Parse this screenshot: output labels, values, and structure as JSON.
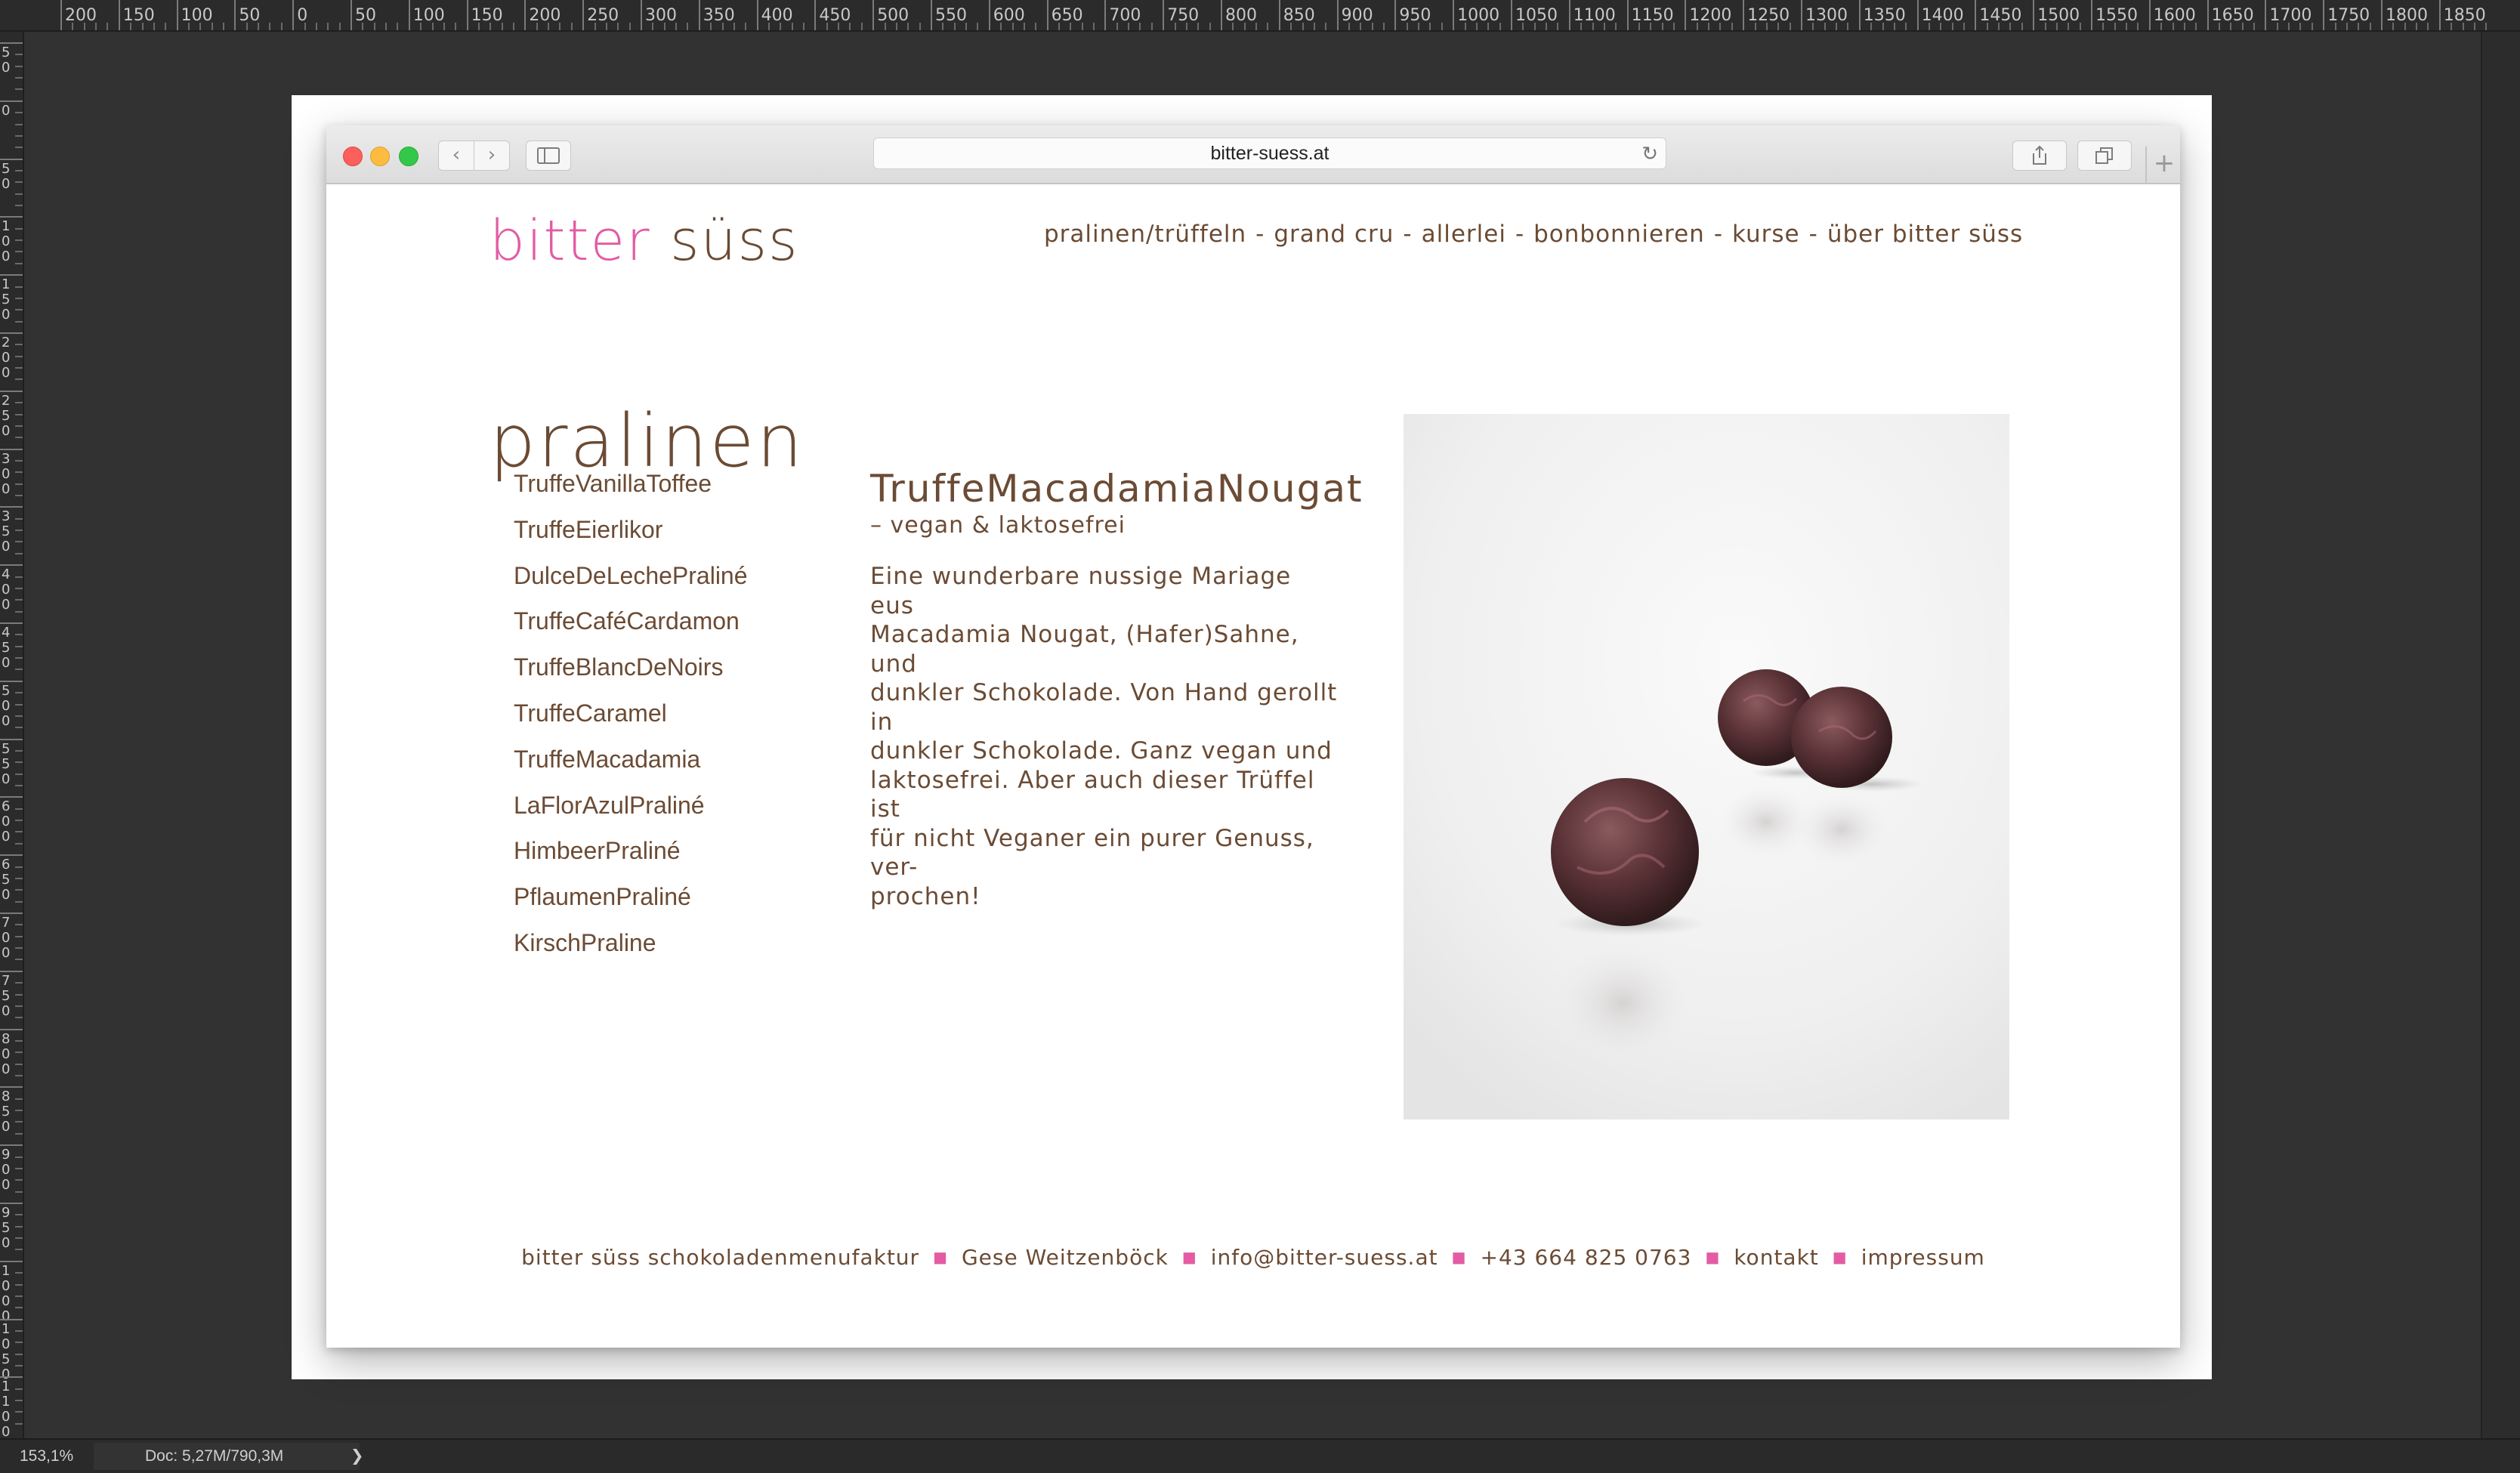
{
  "photoshop": {
    "ruler_labels": [
      "200",
      "150",
      "100",
      "50",
      "0",
      "50",
      "100",
      "150",
      "200",
      "250",
      "300",
      "350",
      "400",
      "450",
      "500",
      "550",
      "600",
      "650",
      "700",
      "750",
      "800",
      "850",
      "900",
      "950",
      "1000",
      "1050",
      "1100",
      "1150",
      "1200",
      "1250",
      "1300",
      "1350",
      "1400",
      "1450",
      "1500",
      "1550",
      "1600",
      "1650",
      "1700",
      "1750",
      "1800",
      "1850"
    ],
    "left_ruler_labels": [
      "5 0",
      "0",
      "5 0",
      "1 0 0",
      "1 5 0",
      "2 0 0",
      "2 5 0",
      "3 0 0",
      "3 5 0",
      "4 0 0",
      "4 5 0",
      "5 0 0",
      "5 5 0",
      "6 0 0",
      "6 5 0",
      "7 0 0",
      "7 5 0",
      "8 0 0",
      "8 5 0",
      "9 0 0",
      "9 5 0",
      "1 0 0 0",
      "1 0 5 0",
      "1 1 0 0"
    ],
    "zoom": "153,1%",
    "doc_info": "Doc: 5,27M/790,3M",
    "status_arrow": "❯"
  },
  "browser": {
    "url": "bitter-suess.at",
    "back_glyph": "‹",
    "forward_glyph": "›",
    "sidebar_glyph": "▯",
    "reload_glyph": "↻",
    "share_glyph": "⇧",
    "tabs_glyph": "⧉",
    "newtab_glyph": "+"
  },
  "site": {
    "logo": {
      "part1": "bitter",
      "part2": "süss"
    },
    "colors": {
      "accent": "#e45ba4",
      "text": "#6b4b34"
    },
    "nav": [
      "pralinen/trüffeln",
      "grand cru",
      "allerlei",
      "bonbonnieren",
      "kurse",
      "über bitter süss"
    ],
    "nav_separator": "-",
    "page_title": "pralinen",
    "pralinen_list": [
      "TruffeVanillaToffee",
      "TruffeEierlikor",
      "DulceDeLechePraliné",
      "TruffeCaféCardamon",
      "TruffeBlancDeNoirs",
      "TruffeCaramel",
      "TruffeMacadamia",
      "LaFlorAzulPraliné",
      "HimbeerPraliné",
      "PflaumenPraliné",
      "KirschPraline"
    ],
    "product": {
      "name": "TruffeMacadamiaNougat",
      "subtitle": "– vegan & laktosefrei",
      "description": "Eine wunderbare nussige Mariage eus\nMacadamia Nougat, (Hafer)Sahne, und\ndunkler Schokolade. Von Hand gerollt in\ndunkler Schokolade. Ganz vegan und\nlaktosefrei. Aber auch dieser Trüffel ist\nfür nicht Veganer ein purer Genuss, ver-\nprochen!"
    },
    "footer": {
      "company": "bitter süss schokoladenmenufaktur",
      "person": "Gese Weitzenböck",
      "email": "info@bitter-suess.at",
      "phone": "+43 664 825 0763",
      "contact": "kontakt",
      "imprint": "impressum",
      "separator": "■"
    }
  }
}
